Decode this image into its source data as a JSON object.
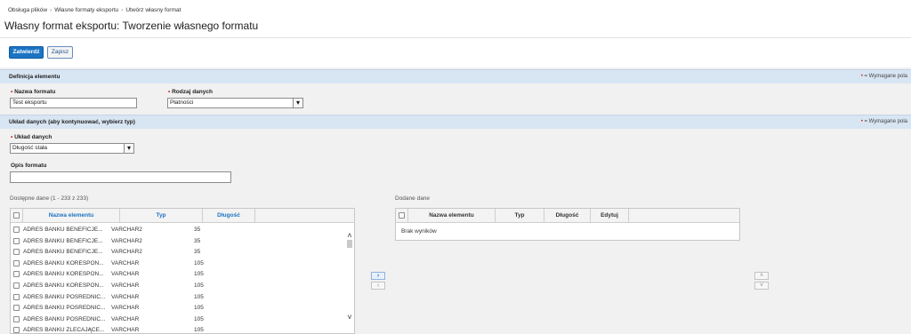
{
  "breadcrumb": [
    "Obsługa plików",
    "Własne formaty eksportu",
    "Utwórz własny format"
  ],
  "breadcrumb_separator": "›",
  "page_title": "Własny format eksportu: Tworzenie własnego formatu",
  "actions": {
    "submit_label": "Zatwierdź",
    "save_label": "Zapisz"
  },
  "required_marker": "•",
  "required_note": "= Wymagane pola",
  "section_definition": {
    "title": "Definicja elementu",
    "name_label": "Nazwa formatu",
    "name_value": "Test eksportu",
    "data_type_label": "Rodzaj danych",
    "data_type_value": "Płatności"
  },
  "section_layout": {
    "title": "Układ danych (aby kontynuować, wybierz typ)",
    "layout_label": "Układ danych",
    "layout_value": "Długość stała",
    "description_label": "Opis formatu",
    "description_value": ""
  },
  "available": {
    "title": "Dostępne dane (1 - 233 z 233)",
    "columns": [
      "Nazwa elementu",
      "Typ",
      "Długość"
    ],
    "rows": [
      [
        "ADRES BANKU BENEFICJE...",
        "VARCHAR2",
        "35"
      ],
      [
        "ADRES BANKU BENEFICJE...",
        "VARCHAR2",
        "35"
      ],
      [
        "ADRES BANKU BENEFICJE...",
        "VARCHAR2",
        "35"
      ],
      [
        "ADRES BANKU KORESPON...",
        "VARCHAR",
        "105"
      ],
      [
        "ADRES BANKU KORESPON...",
        "VARCHAR",
        "105"
      ],
      [
        "ADRES BANKU KORESPON...",
        "VARCHAR",
        "105"
      ],
      [
        "ADRES BANKU POSREDNIC...",
        "VARCHAR",
        "105"
      ],
      [
        "ADRES BANKU POSREDNIC...",
        "VARCHAR",
        "105"
      ],
      [
        "ADRES BANKU POSREDNIC...",
        "VARCHAR",
        "105"
      ],
      [
        "ADRES BANKU ZLECAJĄCE...",
        "VARCHAR",
        "105"
      ]
    ]
  },
  "added": {
    "title": "Dodane dane",
    "columns": [
      "Nazwa elementu",
      "Typ",
      "Długość",
      "Edytuj"
    ],
    "empty_text": "Brak wyników"
  },
  "icons": {
    "move_right": "›",
    "move_left": "‹",
    "move_up": "˄",
    "move_down": "˅",
    "scroll_up": "˄",
    "scroll_down": "˅",
    "select_arrow": "▾"
  },
  "colors": {
    "primary": "#1b73c3",
    "section_bg": "#d8e5f3",
    "required": "#d01c1c"
  }
}
